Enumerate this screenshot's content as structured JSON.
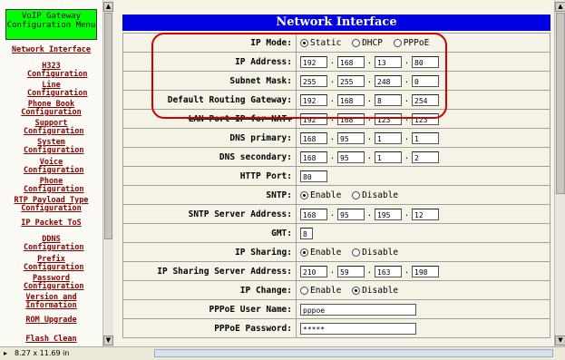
{
  "left_menu": {
    "title": "VoIP Gateway Configuration Menu",
    "items": [
      "Network Interface",
      "H323 Configuration",
      "Line Configuration",
      "Phone Book Configuration",
      "Support Configuration",
      "System Configuration",
      "Voice Configuration",
      "Phone Configuration",
      "RTP Payload Type Configuration",
      "IP Packet ToS",
      "DDNS Configuration",
      "Prefix Configuration",
      "Password Configuration",
      "Version and Information",
      "ROM Upgrade",
      "Flash Clean"
    ]
  },
  "page_title": "Network Interface",
  "ip_mode": {
    "label": "IP Mode:",
    "options": [
      "Static",
      "DHCP",
      "PPPoE"
    ],
    "selected": "Static"
  },
  "ip_address": {
    "label": "IP Address:",
    "octets": [
      "192",
      "168",
      "13",
      "80"
    ]
  },
  "subnet_mask": {
    "label": "Subnet Mask:",
    "octets": [
      "255",
      "255",
      "248",
      "0"
    ]
  },
  "default_gateway": {
    "label": "Default Routing Gateway:",
    "octets": [
      "192",
      "168",
      "8",
      "254"
    ]
  },
  "lan_port_ip": {
    "label": "LAN Port IP for NAT:",
    "octets": [
      "192",
      "168",
      "123",
      "123"
    ]
  },
  "dns_primary": {
    "label": "DNS primary:",
    "octets": [
      "168",
      "95",
      "1",
      "1"
    ]
  },
  "dns_secondary": {
    "label": "DNS secondary:",
    "octets": [
      "168",
      "95",
      "1",
      "2"
    ]
  },
  "http_port": {
    "label": "HTTP Port:",
    "value": "80"
  },
  "sntp": {
    "label": "SNTP:",
    "options": [
      "Enable",
      "Disable"
    ],
    "selected": "Enable"
  },
  "sntp_server": {
    "label": "SNTP Server Address:",
    "octets": [
      "168",
      "95",
      "195",
      "12"
    ]
  },
  "gmt": {
    "label": "GMT:",
    "value": "8"
  },
  "ip_sharing": {
    "label": "IP Sharing:",
    "options": [
      "Enable",
      "Disable"
    ],
    "selected": "Enable"
  },
  "ip_sharing_server": {
    "label": "IP Sharing Server Address:",
    "octets": [
      "210",
      "59",
      "163",
      "198"
    ]
  },
  "ip_change": {
    "label": "IP Change:",
    "options": [
      "Enable",
      "Disable"
    ],
    "selected": "Disable"
  },
  "pppoe_user": {
    "label": "PPPoE User Name:",
    "value": "pppoe"
  },
  "pppoe_password": {
    "label": "PPPoE Password:",
    "value": "*****"
  },
  "status_bar": {
    "page_size": "8.27 x 11.69 in"
  },
  "colors": {
    "title_bg": "#0000e0",
    "menu_title_bg": "#00ff00",
    "nav_link": "#8b0000",
    "annotation": "#d00000"
  }
}
